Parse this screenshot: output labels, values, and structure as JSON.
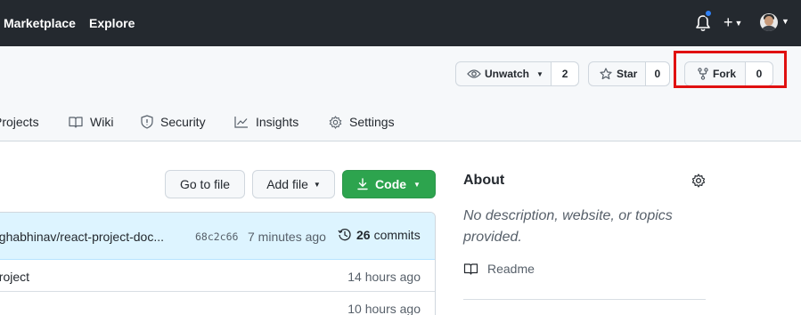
{
  "header": {
    "nav": [
      "Marketplace",
      "Explore"
    ],
    "plus_label": "+",
    "icons": [
      "bell-icon",
      "plus-icon",
      "avatar"
    ]
  },
  "repo_actions": {
    "watch": {
      "label": "Unwatch",
      "count": "2"
    },
    "star": {
      "label": "Star",
      "count": "0"
    },
    "fork": {
      "label": "Fork",
      "count": "0"
    }
  },
  "tabs": [
    {
      "label": "Projects",
      "icon": "project-icon"
    },
    {
      "label": "Wiki",
      "icon": "book-icon"
    },
    {
      "label": "Security",
      "icon": "shield-icon"
    },
    {
      "label": "Insights",
      "icon": "graph-icon"
    },
    {
      "label": "Settings",
      "icon": "gear-icon"
    }
  ],
  "toolbar": {
    "go_to_file": "Go to file",
    "add_file": "Add file",
    "code": "Code"
  },
  "commit": {
    "message": "nghabhinav/react-project-doc...",
    "sha": "68c2c66",
    "time": "7 minutes ago",
    "count": "26",
    "count_label": "commits"
  },
  "files": [
    {
      "name": "project",
      "age": "14 hours ago"
    },
    {
      "name": "",
      "age": "10 hours ago"
    }
  ],
  "about": {
    "title": "About",
    "description": "No description, website, or topics provided.",
    "readme": "Readme"
  },
  "colors": {
    "header_bg": "#24292f",
    "code_button": "#2da44e",
    "highlight": "#e01010",
    "commit_bar": "#ddf4ff"
  }
}
